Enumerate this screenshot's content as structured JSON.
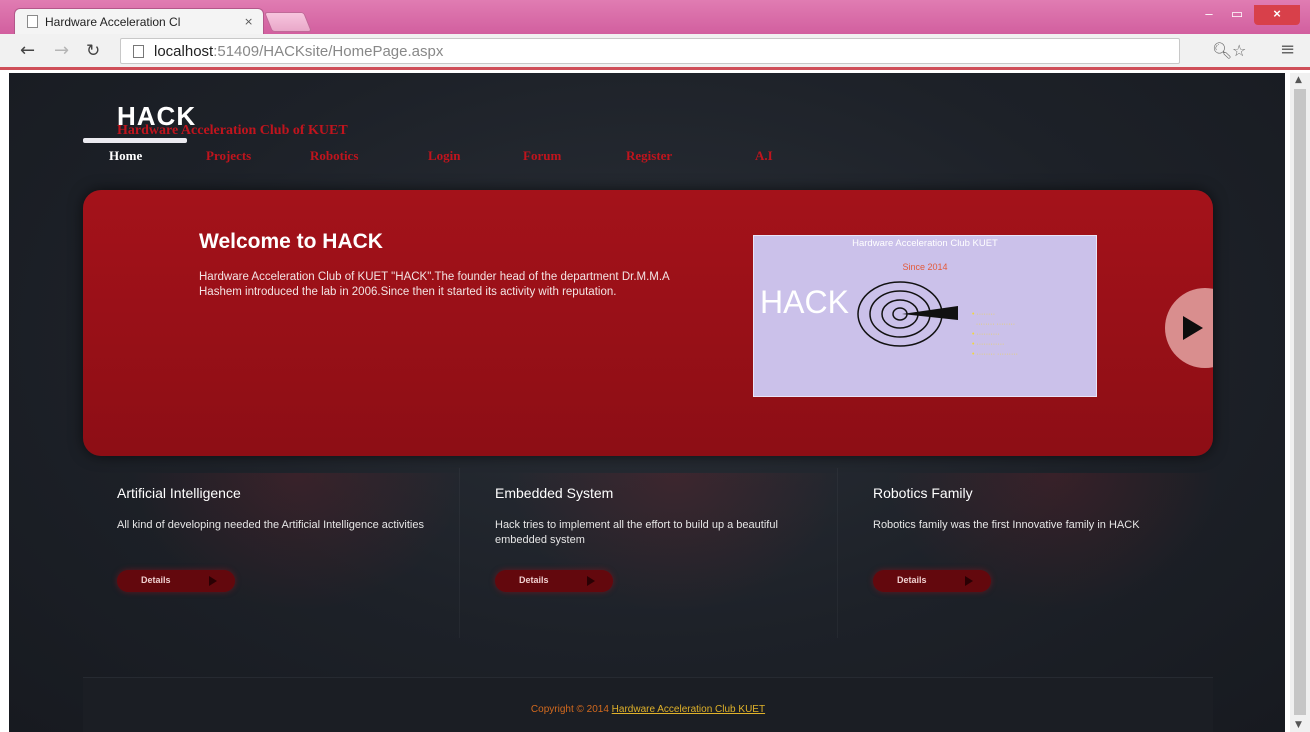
{
  "browser": {
    "tab_title": "Hardware Acceleration Cl",
    "tab_close": "×",
    "url_host": "localhost",
    "url_path": ":51409/HACKsite/HomePage.aspx",
    "min_glyph": "–",
    "max_glyph": "▭",
    "close_glyph": "×"
  },
  "site": {
    "logo": "HACK",
    "tagline": "Hardware Acceleration Club of KUET",
    "nav": [
      {
        "label": "Home"
      },
      {
        "label": "Projects"
      },
      {
        "label": "Robotics"
      },
      {
        "label": "Login"
      },
      {
        "label": "Forum"
      },
      {
        "label": "Register"
      },
      {
        "label": "A.I"
      }
    ]
  },
  "hero": {
    "title": "Welcome to HACK",
    "text": "Hardware Acceleration Club of KUET \"HACK\".The founder head of the department Dr.M.M.A Hashem introduced the lab in 2006.Since then it started its activity with reputation.",
    "image": {
      "heading": "Hardware Acceleration Club KUET",
      "since": "Since 2014",
      "logo_text": "HACK"
    }
  },
  "features": [
    {
      "title": "Artificial Intelligence",
      "text": "All kind of developing needed the Artificial Intelligence activities",
      "button": "Details"
    },
    {
      "title": "Embedded System",
      "text": "Hack tries to implement all the effort to build up a beautiful embedded system",
      "button": "Details"
    },
    {
      "title": "Robotics Family",
      "text": "Robotics family was the first Innovative family in HACK",
      "button": "Details"
    }
  ],
  "footer": {
    "prefix": "Copyright © 2014 ",
    "link": "Hardware Acceleration Club KUET"
  },
  "colors": {
    "accent_red": "#c0141d",
    "hero_bg": "#9a1018",
    "page_bg": "#1e2229",
    "footer_text": "#d2691e",
    "titlebar": "#d8629f"
  },
  "icons": [
    "page-icon",
    "back-arrow-icon",
    "forward-arrow-icon",
    "reload-icon",
    "zoom-icon",
    "star-icon",
    "menu-icon",
    "next-slide-icon",
    "target-icon"
  ]
}
